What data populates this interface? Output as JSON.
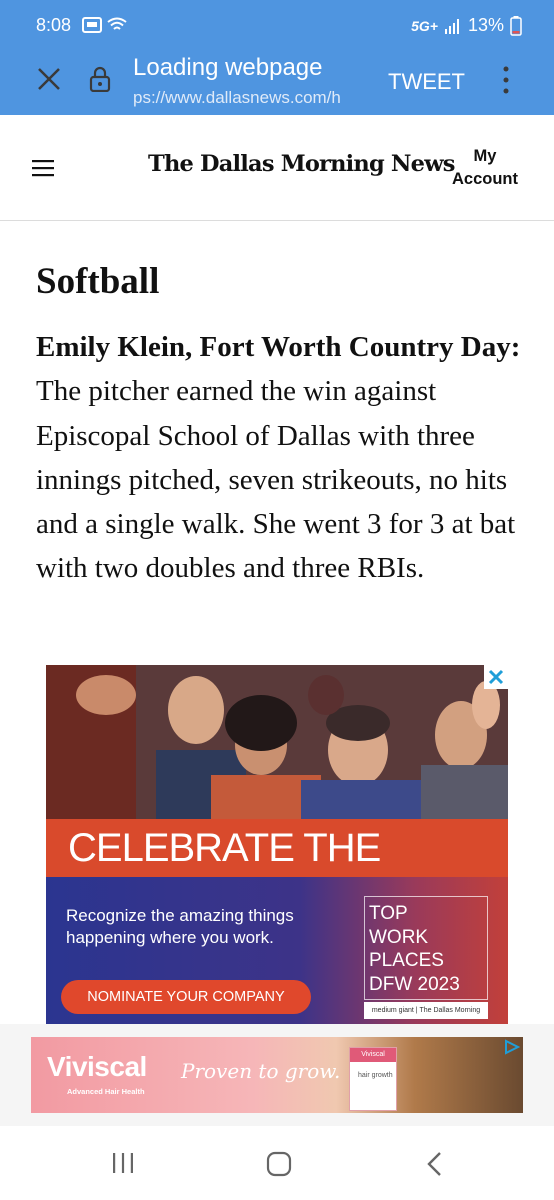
{
  "status_bar": {
    "time": "8:08",
    "network": "5G+",
    "battery": "13%"
  },
  "browser_toolbar": {
    "title": "Loading webpage",
    "url": "ps://www.dallasnews.com/h",
    "tweet_label": "TWEET"
  },
  "site_header": {
    "logo_text": "The Dallas Morning News",
    "account_line1": "My",
    "account_line2": "Account"
  },
  "article": {
    "section_heading": "Softball",
    "athlete": "Emily Klein, Fort Worth Country Day:",
    "body": " The pitcher earned the win against Episcopal School of Dallas with three innings pitched, seven strikeouts, no hits and a single walk. She went 3 for 3 at bat with two doubles and three RBIs."
  },
  "ad_top_workplaces": {
    "headline": "CELEBRATE THE GOOD",
    "copy": "Recognize the amazing things happening where you work.",
    "cta": "NOMINATE YOUR COMPANY",
    "badge_line1": "TOP",
    "badge_line2": "WORK",
    "badge_line3": "PLACES",
    "badge_line4": "DFW 2023",
    "badge_footer": "medium giant | The Dallas Morning News"
  },
  "ad_viviscal": {
    "brand": "Viviscal",
    "brand_sub": "Advanced Hair Health",
    "tagline": "Proven to grow.",
    "box_label": "Viviscal",
    "box_text": "hair growth"
  },
  "colors": {
    "browser_bar": "#4f95e0",
    "ad_red": "#d94a2c",
    "ad_navy": "#2b3590"
  }
}
